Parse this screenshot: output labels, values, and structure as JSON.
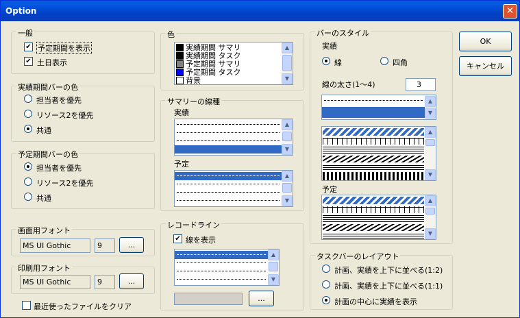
{
  "window": {
    "title": "Option",
    "close": "✕"
  },
  "buttons": {
    "ok": "OK",
    "cancel": "キャンセル",
    "browse": "..."
  },
  "general": {
    "title": "一般",
    "show_planned": "予定期間を表示",
    "show_weekend": "土日表示"
  },
  "actual_bar_color": {
    "title": "実績期間バーの色",
    "options": [
      "担当者を優先",
      "リソース2を優先",
      "共通"
    ],
    "selected": 2
  },
  "planned_bar_color": {
    "title": "予定期間バーの色",
    "options": [
      "担当者を優先",
      "リソース2を優先",
      "共通"
    ],
    "selected": 0
  },
  "screen_font": {
    "title": "画面用フォント",
    "name": "MS UI Gothic",
    "size": "9"
  },
  "print_font": {
    "title": "印刷用フォント",
    "name": "MS UI Gothic",
    "size": "9"
  },
  "clear_recent": "最近使ったファイルをクリア",
  "color": {
    "title": "色",
    "items": [
      {
        "label": "実績期間 サマリ",
        "color": "#000000"
      },
      {
        "label": "実績期間 タスク",
        "color": "#000000"
      },
      {
        "label": "予定期間 サマリ",
        "color": "#808080"
      },
      {
        "label": "予定期間 タスク",
        "color": "#0000ff"
      },
      {
        "label": "背景",
        "color": "#ffffff"
      }
    ]
  },
  "summary_line": {
    "title": "サマリーの線種",
    "actual": "実績",
    "planned": "予定"
  },
  "record_line": {
    "title": "レコードライン",
    "show": "線を表示"
  },
  "bar_style": {
    "title": "バーのスタイル",
    "actual": "実績",
    "line": "線",
    "square": "四角",
    "thickness_label": "線の太さ(1～4)",
    "thickness": "3",
    "planned": "予定"
  },
  "taskbar_layout": {
    "title": "タスクバーのレイアウト",
    "options": [
      "計画、実績を上下に並べる(1:2)",
      "計画、実績を上下に並べる(1:1)",
      "計画の中心に実績を表示"
    ],
    "selected": 2
  },
  "icons": {
    "close": "close-icon",
    "check": "check-icon",
    "scroll_up": "arrow-up-icon",
    "scroll_down": "arrow-down-icon"
  }
}
